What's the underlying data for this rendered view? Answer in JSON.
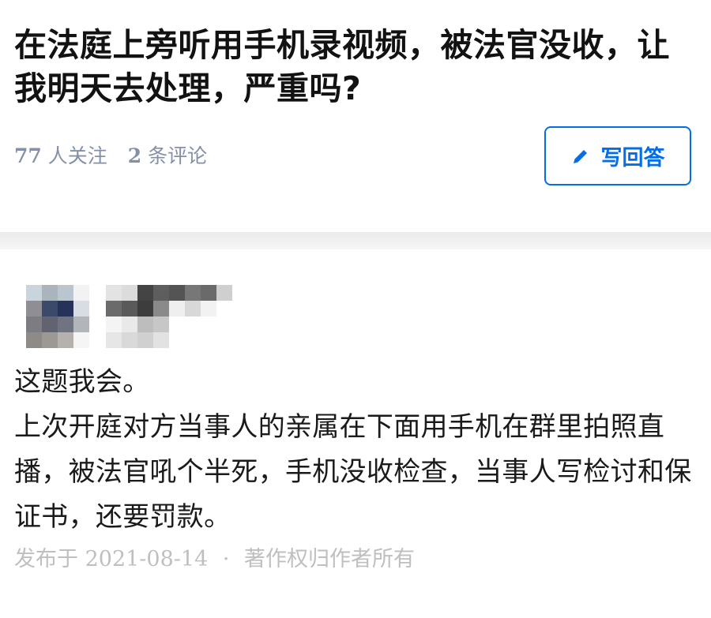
{
  "question": {
    "title": "在法庭上旁听用手机录视频，被法官没收，让我明天去处理，严重吗?",
    "followers_count": "77",
    "followers_label": "人关注",
    "comments_count": "2",
    "comments_label": "条评论",
    "write_answer_label": "写回答",
    "write_answer_icon": "pencil-icon"
  },
  "answer": {
    "paragraphs": [
      "这题我会。",
      "上次开庭对方当事人的亲属在下面用手机在群里拍照直播，被法官吼个半死，手机没收检查，当事人写检讨和保证书，还要罚款。"
    ],
    "published_label": "发布于",
    "published_date": "2021-08-14",
    "separator": "·",
    "copyright": "著作权归作者所有"
  },
  "colors": {
    "accent": "#056de8",
    "meta_text": "#8590a6",
    "footer_text": "#bfbfbf",
    "title_text": "#121212",
    "body_text": "#1a1a1a"
  }
}
